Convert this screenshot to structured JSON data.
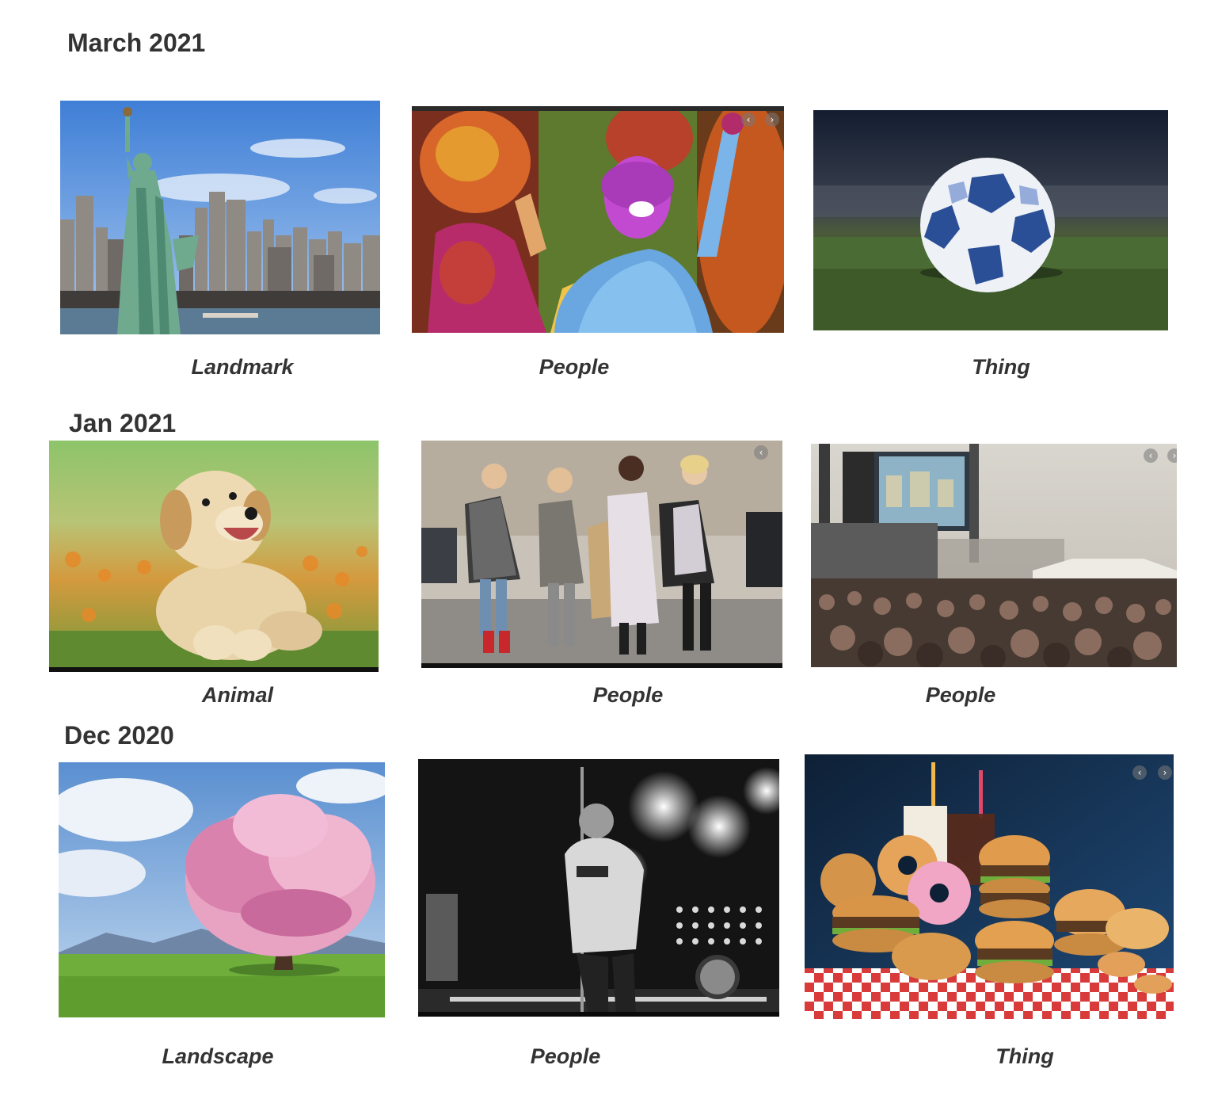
{
  "sections": [
    {
      "title": "March 2021",
      "photos": [
        {
          "caption": "Landmark",
          "subject": "statue-of-liberty-skyline"
        },
        {
          "caption": "People",
          "subject": "holi-festival-crowd"
        },
        {
          "caption": "Thing",
          "subject": "soccer-ball-on-grass"
        }
      ]
    },
    {
      "title": "Jan 2021",
      "photos": [
        {
          "caption": "Animal",
          "subject": "golden-retriever-puppy"
        },
        {
          "caption": "People",
          "subject": "women-street-style"
        },
        {
          "caption": "People",
          "subject": "concert-crowd"
        }
      ]
    },
    {
      "title": "Dec 2020",
      "photos": [
        {
          "caption": "Landscape",
          "subject": "cherry-blossom-tree"
        },
        {
          "caption": "People",
          "subject": "singer-on-stage-bw"
        },
        {
          "caption": "Thing",
          "subject": "fast-food-pile"
        }
      ]
    }
  ],
  "overlays": {
    "prev_arrow": "‹",
    "next_arrow": "›"
  }
}
